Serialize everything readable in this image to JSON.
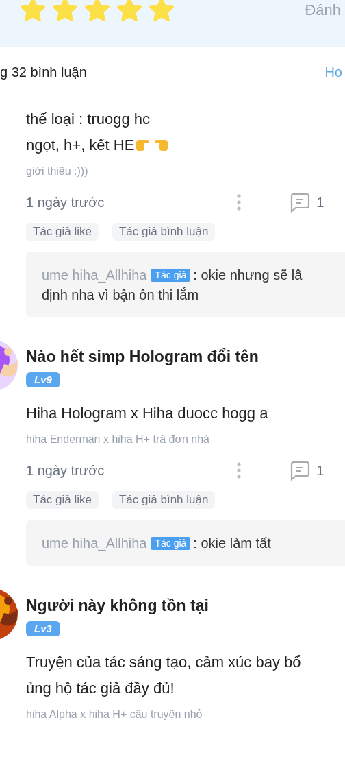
{
  "rating": {
    "stars": 5,
    "label": "Đánh"
  },
  "comments_header": {
    "count_label": "g 32 bình luận",
    "action": "Ho"
  },
  "comments": [
    {
      "body": [
        "thể loại : truogg hc",
        "ngọt, h+, kết HE"
      ],
      "pointing_hands": true,
      "intro": "giới thiệu :)))",
      "time": "1 ngày trước",
      "reply_count": "1",
      "tags": [
        "Tác giả like",
        "Tác giả bình luận"
      ],
      "reply": {
        "author": "ume hiha_Allhiha",
        "badge": "Tác giả",
        "lines": [
          ": okie nhưng sẽ lâ",
          "định nha vì bận ôn thi lắm"
        ]
      }
    },
    {
      "name": "Nào hết simp Hologram đổi tên",
      "level": "Lv9",
      "body": [
        "Hiha Hologram x Hiha duocc hogg a"
      ],
      "pointing_hands": false,
      "intro": "hiha Enderman x hiha H+ trả đơn nhá",
      "time": "1 ngày trước",
      "reply_count": "1",
      "tags": [
        "Tác giả like",
        "Tác giả bình luận"
      ],
      "reply": {
        "author": "ume hiha_Allhiha",
        "badge": "Tác giả",
        "lines": [
          ": okie làm tất"
        ]
      }
    },
    {
      "name": "Người này không tồn tại",
      "level": "Lv3",
      "body": [
        "Truyện của tác sáng tạo, cảm xúc bay bổ",
        "ủng hộ tác giả đầy đủ!"
      ],
      "pointing_hands": false,
      "intro": "hiha Alpha x hiha H+ câu truyện nhỏ"
    }
  ]
}
